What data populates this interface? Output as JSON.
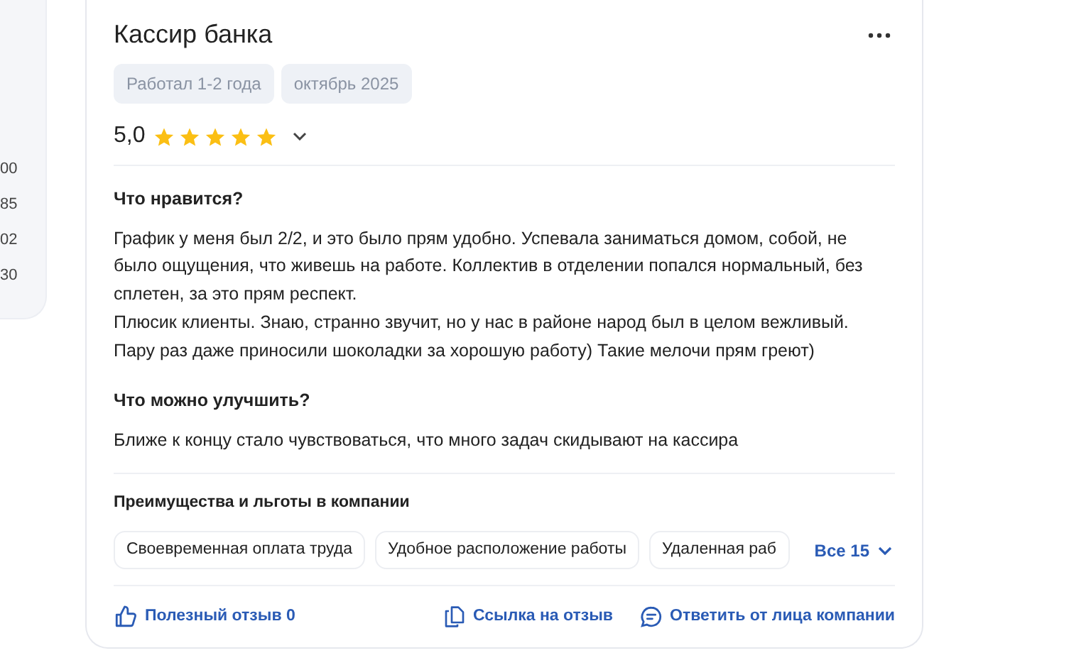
{
  "side_panel": {
    "values": [
      "00",
      "85",
      "02",
      "30"
    ]
  },
  "review": {
    "title": "Кассир банка",
    "tags": [
      "Работал 1-2 года",
      "октябрь 2025"
    ],
    "rating": "5,0",
    "stars": 5,
    "sections": [
      {
        "heading": "Что нравится?",
        "text": "График у меня был 2/2, и это было прям удобно. Успевала заниматься домом, собой, не было ощущения, что живешь на работе. Коллектив в отделении попался нормальный, без сплетен, за это прям респект.\nПлюсик клиенты. Знаю, странно звучит, но у нас в районе народ был в целом вежливый. Пару раз даже приносили шоколадки за хорошую работу) Такие мелочи прям греют)"
      },
      {
        "heading": "Что можно улучшить?",
        "text": "Ближе к концу стало чувствоваться, что много задач скидывают на кассира"
      }
    ],
    "benefits": {
      "heading": "Преимущества и льготы в компании",
      "items": [
        "Своевременная оплата труда",
        "Удобное расположение работы",
        "Удаленная раб"
      ],
      "more": "Все 15"
    },
    "actions": [
      {
        "kind": "like",
        "label": "Полезный отзыв 0"
      },
      {
        "kind": "link",
        "label": "Ссылка на отзыв"
      },
      {
        "kind": "reply",
        "label": "Ответить от лица компании"
      }
    ]
  }
}
